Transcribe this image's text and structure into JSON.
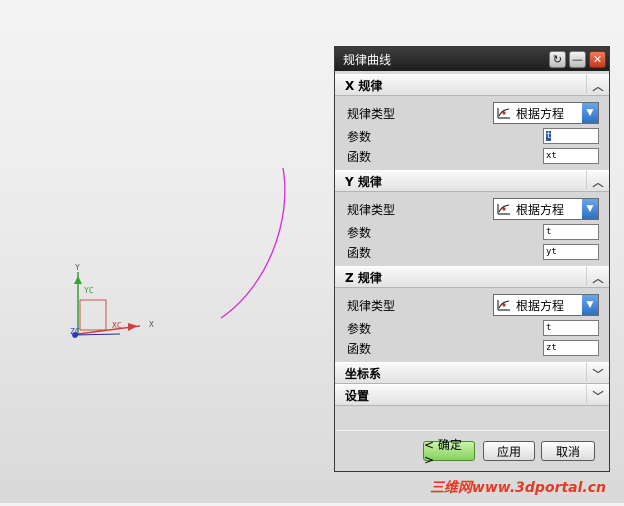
{
  "dialog": {
    "title": "规律曲线",
    "sections": [
      {
        "header": "X 规律",
        "law_type_label": "规律类型",
        "law_type_value": "根据方程",
        "param_label": "参数",
        "param_value": "t",
        "func_label": "函数",
        "func_value": "xt"
      },
      {
        "header": "Y 规律",
        "law_type_label": "规律类型",
        "law_type_value": "根据方程",
        "param_label": "参数",
        "param_value": "t",
        "func_label": "函数",
        "func_value": "yt"
      },
      {
        "header": "Z 规律",
        "law_type_label": "规律类型",
        "law_type_value": "根据方程",
        "param_label": "参数",
        "param_value": "t",
        "func_label": "函数",
        "func_value": "zt"
      }
    ],
    "collapsed": {
      "csys": "坐标系",
      "settings": "设置"
    },
    "buttons": {
      "ok": "< 确定 >",
      "apply": "应用",
      "cancel": "取消"
    }
  },
  "viewport": {
    "axes": {
      "y": "Y",
      "yc": "YC",
      "x": "X",
      "xc": "XC",
      "zc": "ZC"
    },
    "curve_color": "#d62ad6"
  },
  "watermark": "三维网www.3dportal.cn",
  "colors": {
    "accent_blue": "#2c6fc4",
    "ok_green": "#86d25c",
    "close_red": "#c8381b"
  }
}
